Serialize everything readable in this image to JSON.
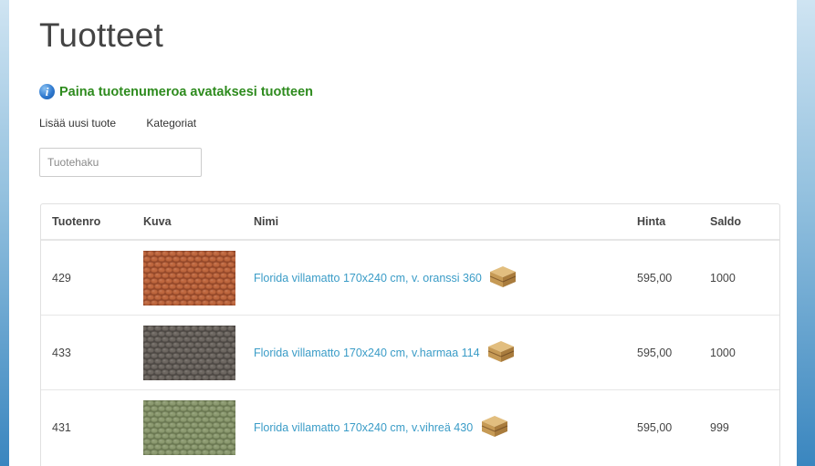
{
  "page": {
    "title": "Tuotteet"
  },
  "info": {
    "message": "Paina tuotenumeroa avataksesi tuotteen",
    "icon": "info-icon"
  },
  "actions": {
    "add_product": "Lisää uusi tuote",
    "categories": "Kategoriat"
  },
  "search": {
    "placeholder": "Tuotehaku",
    "value": ""
  },
  "table": {
    "headers": {
      "number": "Tuotenro",
      "image": "Kuva",
      "name": "Nimi",
      "price": "Hinta",
      "stock": "Saldo"
    },
    "rows": [
      {
        "number": "429",
        "name": "Florida villamatto 170x240 cm, v. oranssi 360",
        "price": "595,00",
        "stock": "1000",
        "thumb_color": "#c0683f",
        "thumb_dark": "#8f4528"
      },
      {
        "number": "433",
        "name": "Florida villamatto 170x240 cm, v.harmaa 114",
        "price": "595,00",
        "stock": "1000",
        "thumb_color": "#6e6862",
        "thumb_dark": "#4a4541"
      },
      {
        "number": "431",
        "name": "Florida villamatto 170x240 cm, v.vihreä 430",
        "price": "595,00",
        "stock": "999",
        "thumb_color": "#8e9c72",
        "thumb_dark": "#67744f"
      }
    ]
  },
  "colors": {
    "link": "#3a9cc7",
    "info_green": "#2e8b1e",
    "box": "#c69a55"
  }
}
